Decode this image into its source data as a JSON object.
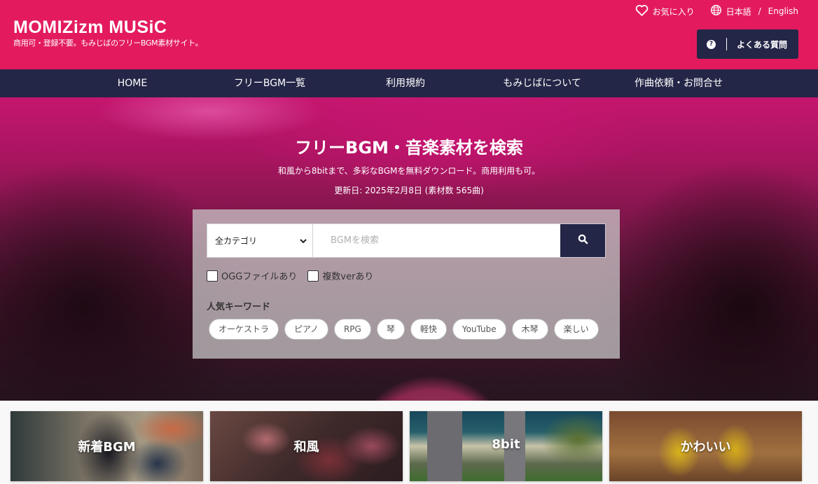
{
  "header": {
    "logo": "MOMIZizm MUSiC",
    "tagline": "商用可・登録不要。もみじばのフリーBGM素材サイト。",
    "favorites_label": "お気に入り",
    "lang_japanese": "日本語",
    "lang_separator": "/",
    "lang_english": "English",
    "faq_icon_glyph": "?",
    "faq_label": "よくある質問"
  },
  "nav": {
    "items": [
      {
        "label": "HOME"
      },
      {
        "label": "フリーBGM一覧"
      },
      {
        "label": "利用規約"
      },
      {
        "label": "もみじばについて"
      },
      {
        "label": "作曲依頼・お問合せ"
      }
    ]
  },
  "hero": {
    "title": "フリーBGM・音楽素材を検索",
    "subtitle": "和風から8bitまで、多彩なBGMを無料ダウンロード。商用利用も可。",
    "updated": "更新日: 2025年2月8日 (素材数 565曲)"
  },
  "search": {
    "category_selected": "全カテゴリ",
    "placeholder": "BGMを検索",
    "value": "",
    "checkboxes": [
      {
        "label": "OGGファイルあり",
        "checked": false
      },
      {
        "label": "複数verあり",
        "checked": false
      }
    ],
    "keywords_title": "人気キーワード",
    "keywords": [
      "オーケストラ",
      "ピアノ",
      "RPG",
      "琴",
      "軽快",
      "YouTube",
      "木琴",
      "楽しい"
    ]
  },
  "categories": [
    {
      "label": "新着BGM"
    },
    {
      "label": "和風"
    },
    {
      "label": "8bit"
    },
    {
      "label": "かわいい"
    }
  ],
  "colors": {
    "brand": "#e31b5e",
    "navy": "#242647"
  }
}
